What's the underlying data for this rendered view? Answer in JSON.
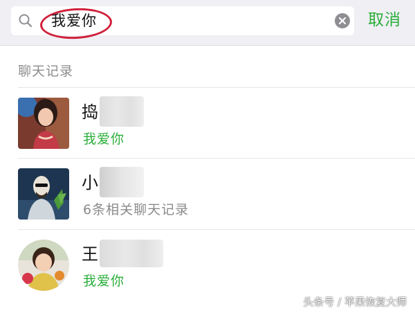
{
  "search": {
    "query": "我爱你",
    "cancel_label": "取消",
    "icon": "search-icon",
    "clear_icon": "clear-icon"
  },
  "section": {
    "title": "聊天记录"
  },
  "results": [
    {
      "name": "捣",
      "detail": "我爱你",
      "detail_color": "#2aae3a",
      "avatar": "girl-avatar"
    },
    {
      "name": "小",
      "detail": "6条相关聊天记录",
      "detail_color": "#8a8a8a",
      "avatar": "illustration-avatar"
    },
    {
      "name": "王",
      "detail": "我爱你",
      "detail_color": "#2aae3a",
      "avatar": "child-avatar"
    }
  ],
  "watermark": "头条号 / 苹果恢复大师",
  "colors": {
    "accent": "#2aae3a",
    "highlight": "#d0203a"
  }
}
